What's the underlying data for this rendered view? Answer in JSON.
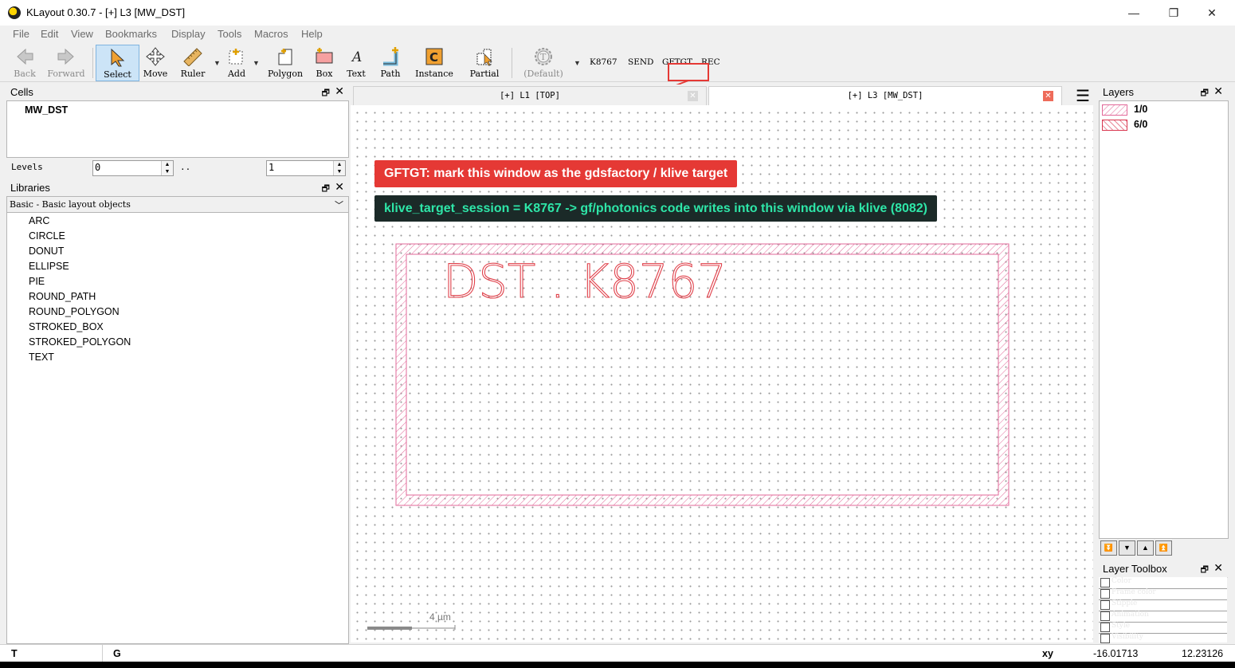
{
  "window": {
    "title": "KLayout 0.30.7 - [+] L3 [MW_DST]",
    "minimize": "—",
    "maximize": "❐",
    "close": "✕"
  },
  "menu": [
    "File",
    "Edit",
    "View",
    "Bookmarks",
    "Display",
    "Tools",
    "Macros",
    "Help"
  ],
  "toolbar": {
    "back": "Back",
    "forward": "Forward",
    "select": "Select",
    "move": "Move",
    "ruler": "Ruler",
    "add": "Add",
    "polygon": "Polygon",
    "box": "Box",
    "text": "Text",
    "path": "Path",
    "instance": "Instance",
    "partial": "Partial",
    "default": "(Default)",
    "k8767": "K8767",
    "send": "SEND",
    "gftgt": "GFTGT",
    "rec": "REC"
  },
  "cells": {
    "title": "Cells",
    "items": [
      "MW_DST"
    ],
    "levels_label": "Levels",
    "level_from": "0",
    "level_sep": "..",
    "level_to": "1"
  },
  "libraries": {
    "title": "Libraries",
    "selected": "Basic - Basic layout objects",
    "items": [
      "ARC",
      "CIRCLE",
      "DONUT",
      "ELLIPSE",
      "PIE",
      "ROUND_PATH",
      "ROUND_POLYGON",
      "STROKED_BOX",
      "STROKED_POLYGON",
      "TEXT"
    ]
  },
  "tabs": [
    {
      "label": "[+] L1 [TOP]",
      "close": "✕"
    },
    {
      "label": "[+] L3 [MW_DST]",
      "close": "✕"
    }
  ],
  "canvas": {
    "callout_red": "GFTGT: mark this window as the gdsfactory / klive target",
    "callout_dark": "klive_target_session = K8767 -> gf/photonics code writes into this window via klive (8082)",
    "layout_text": "DST . K8767",
    "scale_label": "4 µm"
  },
  "layers": {
    "title": "Layers",
    "items": [
      {
        "name": "1/0",
        "color": "#e26a9a"
      },
      {
        "name": "6/0",
        "color": "#d9364f"
      }
    ]
  },
  "layer_toolbox": {
    "title": "Layer Toolbox",
    "rows": [
      "Color",
      "Frame color",
      "Stipple",
      "Animation",
      "Style",
      "Visibility"
    ]
  },
  "status": {
    "left": "T",
    "mode": "G",
    "xy_label": "xy",
    "x": "-16.01713",
    "y": "12.23126"
  },
  "colors": {
    "callout_red": "#e53935",
    "callout_dark": "#1b2a28",
    "callout_dark_text": "#2ee6a8",
    "layer_pink": "#e26a9a",
    "text_red": "#e0404a",
    "annotation_red": "#e53935"
  }
}
